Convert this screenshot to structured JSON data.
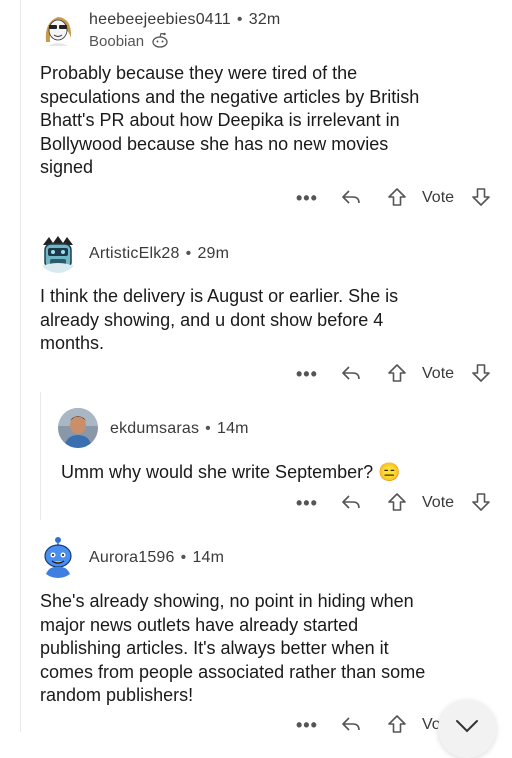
{
  "comments": [
    {
      "username": "heebeejeebies0411",
      "time": "32m",
      "flair": "Boobian",
      "body": "Probably because they were tired of the\nspeculations and the negative articles by British\nBhatt's PR about how Deepika is irrelevant in\nBollywood because she has no new movies\nsigned",
      "vote_label": "Vote"
    },
    {
      "username": "ArtisticElk28",
      "time": "29m",
      "body": "I think the delivery is August or earlier. She is\nalready showing, and u dont show before 4\nmonths.",
      "vote_label": "Vote"
    },
    {
      "username": "ekdumsaras",
      "time": "14m",
      "body": "Umm why would she write September? 😑",
      "vote_label": "Vote"
    },
    {
      "username": "Aurora1596",
      "time": "14m",
      "body": "She's already showing, no point in hiding when\nmajor news outlets have already started\npublishing articles. It's always better when it\ncomes from people associated rather than some\nrandom publishers!",
      "vote_label": "Vo"
    }
  ],
  "ui": {
    "more_glyph": "•••",
    "separator": "•"
  },
  "colors": {
    "text": "#1a1a1b",
    "meta": "#555555",
    "thread_line": "#e9e9e9"
  }
}
